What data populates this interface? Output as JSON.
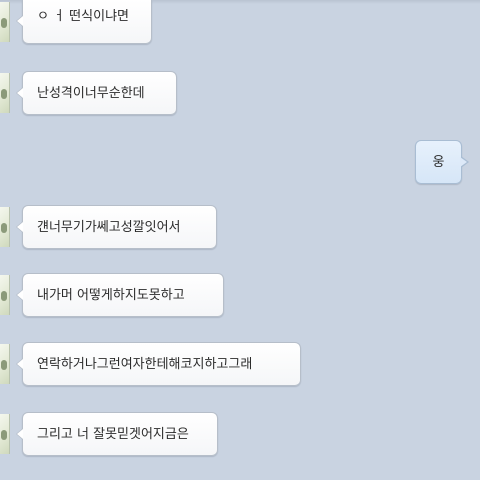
{
  "messages": [
    {
      "side": "in",
      "text": "ㅇ ㅓ 떤식이냐면"
    },
    {
      "side": "in",
      "text": "난성격이너무순한데"
    },
    {
      "side": "out",
      "text": "웅"
    },
    {
      "side": "in",
      "text": "걘너무기가쎄고성깔잇어서"
    },
    {
      "side": "in",
      "text": "내가머 어떻게하지도못하고"
    },
    {
      "side": "in",
      "text": "연락하거나그런여자한테해코지하고그래"
    },
    {
      "side": "in",
      "text": "그리고 너 잘못믿겟어지금은"
    }
  ],
  "colors": {
    "background": "#c9d3e1",
    "incoming_bubble": "#ffffff",
    "outgoing_bubble": "#dde9f8"
  },
  "icons": {
    "avatar": "sender-avatar-image"
  }
}
